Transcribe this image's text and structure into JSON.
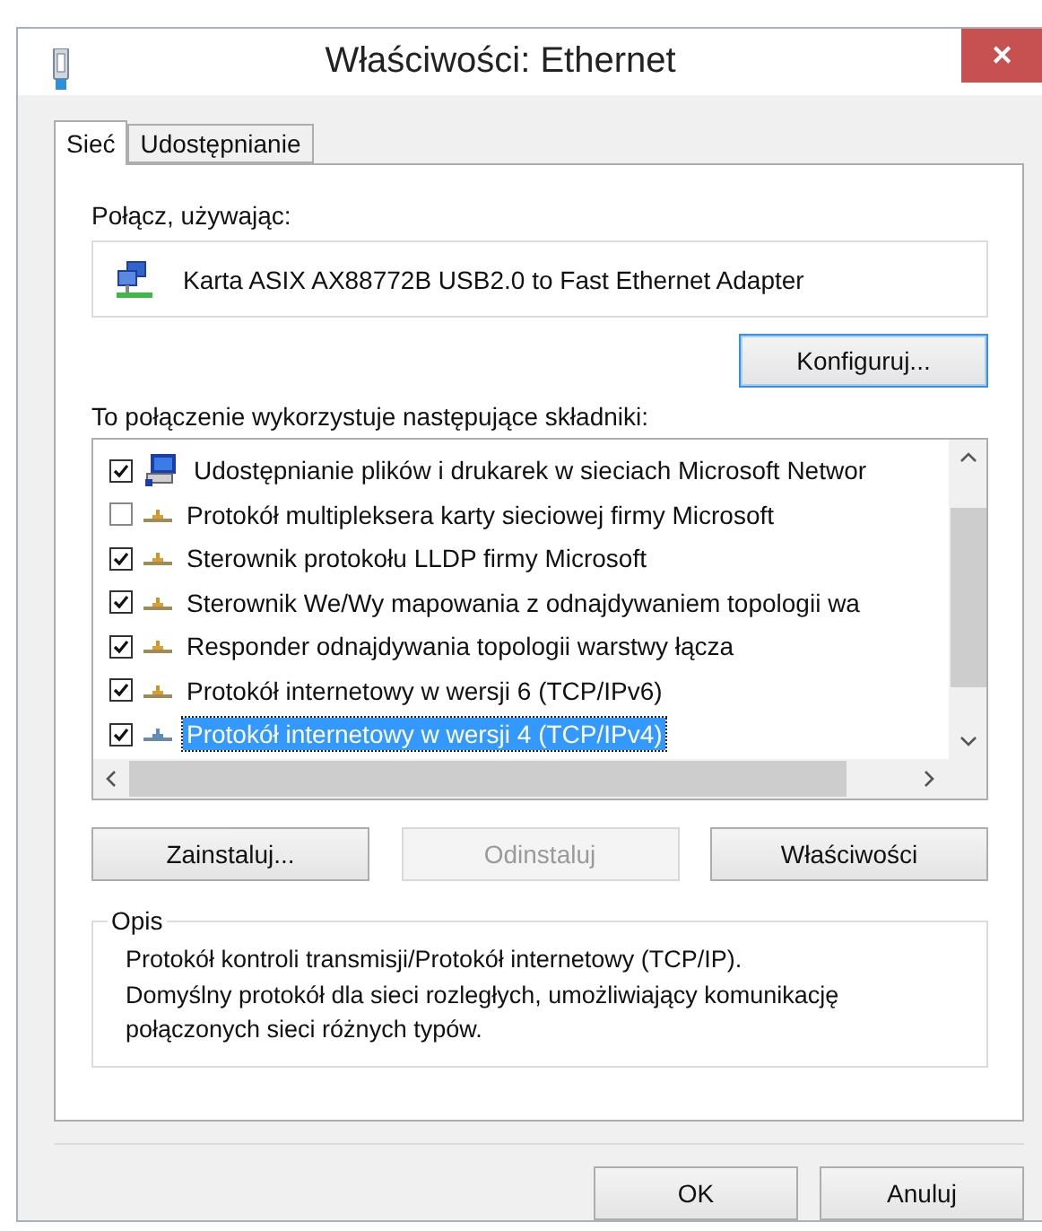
{
  "window": {
    "title": "Właściwości: Ethernet",
    "close": "✕"
  },
  "tabs": [
    {
      "label": "Sieć",
      "selected": true
    },
    {
      "label": "Udostępnianie",
      "selected": false
    }
  ],
  "connect_using": {
    "label": "Połącz, używając:",
    "adapter": "Karta ASIX AX88772B USB2.0 to Fast Ethernet Adapter"
  },
  "configure_button": {
    "label": "Konfiguruj...",
    "focused": true
  },
  "components": {
    "label": "To połączenie wykorzystuje następujące składniki:",
    "items": [
      {
        "label": "Udostępnianie plików i drukarek w sieciach Microsoft Networ",
        "checked": true,
        "selected": false,
        "kind": "service"
      },
      {
        "label": "Protokół multipleksera karty sieciowej firmy Microsoft",
        "checked": false,
        "selected": false,
        "kind": "protocol"
      },
      {
        "label": "Sterownik protokołu LLDP firmy Microsoft",
        "checked": true,
        "selected": false,
        "kind": "protocol"
      },
      {
        "label": "Sterownik We/Wy mapowania z odnajdywaniem topologii wa",
        "checked": true,
        "selected": false,
        "kind": "protocol"
      },
      {
        "label": "Responder odnajdywania topologii warstwy łącza",
        "checked": true,
        "selected": false,
        "kind": "protocol"
      },
      {
        "label": "Protokół internetowy w wersji 6 (TCP/IPv6)",
        "checked": true,
        "selected": false,
        "kind": "protocol"
      },
      {
        "label": "Protokół internetowy w wersji 4 (TCP/IPv4)",
        "checked": true,
        "selected": true,
        "kind": "protocol"
      }
    ]
  },
  "action_buttons": [
    {
      "label": "Zainstaluj...",
      "disabled": false
    },
    {
      "label": "Odinstaluj",
      "disabled": true
    },
    {
      "label": "Właściwości",
      "disabled": false
    }
  ],
  "description": {
    "title": "Opis",
    "text": "Protokół kontroli transmisji/Protokół internetowy (TCP/IP). Domyślny protokół dla sieci rozległych, umożliwiający komunikację połączonych sieci różnych typów."
  },
  "footer_buttons": [
    {
      "label": "OK"
    },
    {
      "label": "Anuluj"
    }
  ]
}
